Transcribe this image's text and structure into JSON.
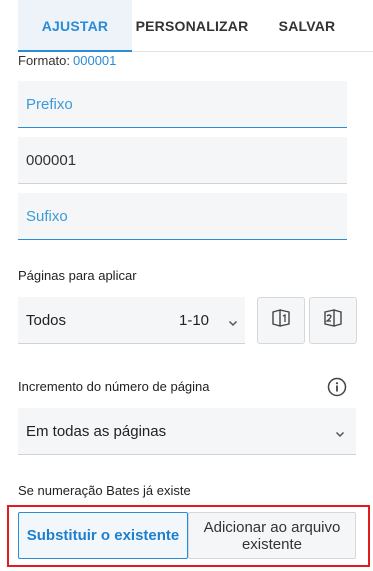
{
  "tabs": [
    {
      "label": "AJUSTAR"
    },
    {
      "label": "PERSONALIZAR"
    },
    {
      "label": "SALVAR"
    }
  ],
  "format": {
    "label": "Formato:",
    "value": "000001"
  },
  "fields": {
    "prefix_placeholder": "Prefixo",
    "number_value": "000001",
    "suffix_placeholder": "Sufixo"
  },
  "pages": {
    "label": "Páginas para aplicar",
    "selected": "Todos",
    "range": "1-10"
  },
  "increment": {
    "label": "Incremento do número de página",
    "selected": "Em todas as páginas"
  },
  "bates": {
    "label": "Se numeração Bates já existe",
    "option_replace": "Substituir o existente",
    "option_add": "Adicionar ao arquivo existente"
  },
  "icons": {
    "odd_pages": "odd-pages-icon",
    "even_pages": "even-pages-icon",
    "info": "info-icon",
    "dropdown": "chevron-down-icon"
  },
  "colors": {
    "accent": "#2a8bd6",
    "highlight_border": "#e01b22"
  }
}
